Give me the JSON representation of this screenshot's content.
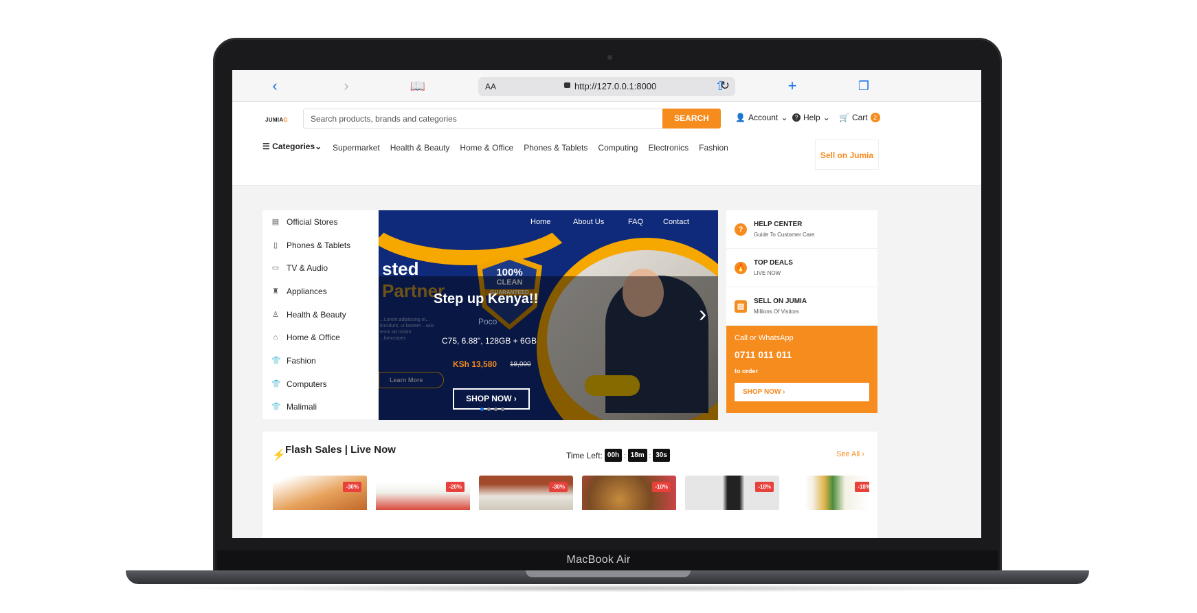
{
  "laptop": {
    "brand": "MacBook Air"
  },
  "browser": {
    "aa_label": "AA",
    "url": "http://127.0.0.1:8000",
    "icons": [
      "back-icon",
      "forward-icon",
      "bookmarks-icon",
      "lock-icon",
      "reload-icon",
      "share-icon",
      "new-tab-icon",
      "tabs-icon"
    ]
  },
  "header": {
    "logo": {
      "text": "JUMIA",
      "accent": "G"
    },
    "search": {
      "placeholder": "Search products, brands and categories",
      "button": "SEARCH"
    },
    "account": "Account",
    "help": "Help",
    "cart": {
      "label": "Cart",
      "count": "2"
    },
    "categories_label": "Categories",
    "menu": [
      "Supermarket",
      "Health & Beauty",
      "Home & Office",
      "Phones & Tablets",
      "Computing",
      "Electronics",
      "Fashion"
    ],
    "sell": "Sell on Jumia"
  },
  "sidebar": {
    "items": [
      {
        "label": "Official Stores",
        "icon": "store-icon"
      },
      {
        "label": "Phones & Tablets",
        "icon": "phone-icon"
      },
      {
        "label": "TV & Audio",
        "icon": "tv-icon"
      },
      {
        "label": "Appliances",
        "icon": "appliance-icon"
      },
      {
        "label": "Health & Beauty",
        "icon": "beauty-icon"
      },
      {
        "label": "Home & Office",
        "icon": "home-icon"
      },
      {
        "label": "Fashion",
        "icon": "shirt-icon"
      },
      {
        "label": "Computers",
        "icon": "shirt-icon"
      },
      {
        "label": "Malimali",
        "icon": "shirt-icon"
      }
    ]
  },
  "hero": {
    "nav": [
      "Home",
      "About Us",
      "FAQ",
      "Contact"
    ],
    "bg_title_1": "sted",
    "bg_title_2": "Partner",
    "bg_small": "...Lorem adipiscing et... tincidunt, ut laoreet ...wisi enim ad minim ...lamcorper.",
    "learn_more": "Learn More",
    "badge": {
      "percent": "100%",
      "clean": "CLEAN",
      "guaranteed": "GUARANTEED"
    },
    "poco": "Poco",
    "headline": "Step up Kenya!!",
    "spec": "C75, 6.88\", 128GB + 6GB",
    "price": "KSh 13,580",
    "old_price": "18,000",
    "cta": "SHOP NOW",
    "slide_count": 4,
    "active_slide": 1
  },
  "right_panel": {
    "items": [
      {
        "title": "HELP CENTER",
        "subtitle": "Guide To Customer Care",
        "icon": "help-icon"
      },
      {
        "title": "TOP DEALS",
        "subtitle": "LIVE NOW",
        "icon": "fire-icon"
      },
      {
        "title": "SELL ON JUMIA",
        "subtitle": "Millions Of Visitors",
        "icon": "store-icon"
      }
    ],
    "call": {
      "title": "Call or WhatsApp",
      "phone": "0711 011 011",
      "subtitle": "to order",
      "button": "SHOP NOW"
    }
  },
  "flash_sales": {
    "title": "Flash Sales | Live Now",
    "time_left_label": "Time Left:",
    "timer": [
      "00h",
      "18m",
      "30s"
    ],
    "see_all": "See All",
    "products": [
      {
        "discount": "-30%",
        "color": "#e7a25b"
      },
      {
        "discount": "-20%",
        "color": "#f0efe9"
      },
      {
        "discount": "-30%",
        "color": "#a14b2c"
      },
      {
        "discount": "-10%",
        "color": "#d8444e"
      },
      {
        "discount": "-18%",
        "color": "#e6e6e6"
      },
      {
        "discount": "-18%",
        "color": "#f4f0e4"
      }
    ]
  },
  "colors": {
    "accent": "#f68b1e",
    "hero_blue": "#0f2a7a",
    "hero_yellow": "#f6a800"
  }
}
